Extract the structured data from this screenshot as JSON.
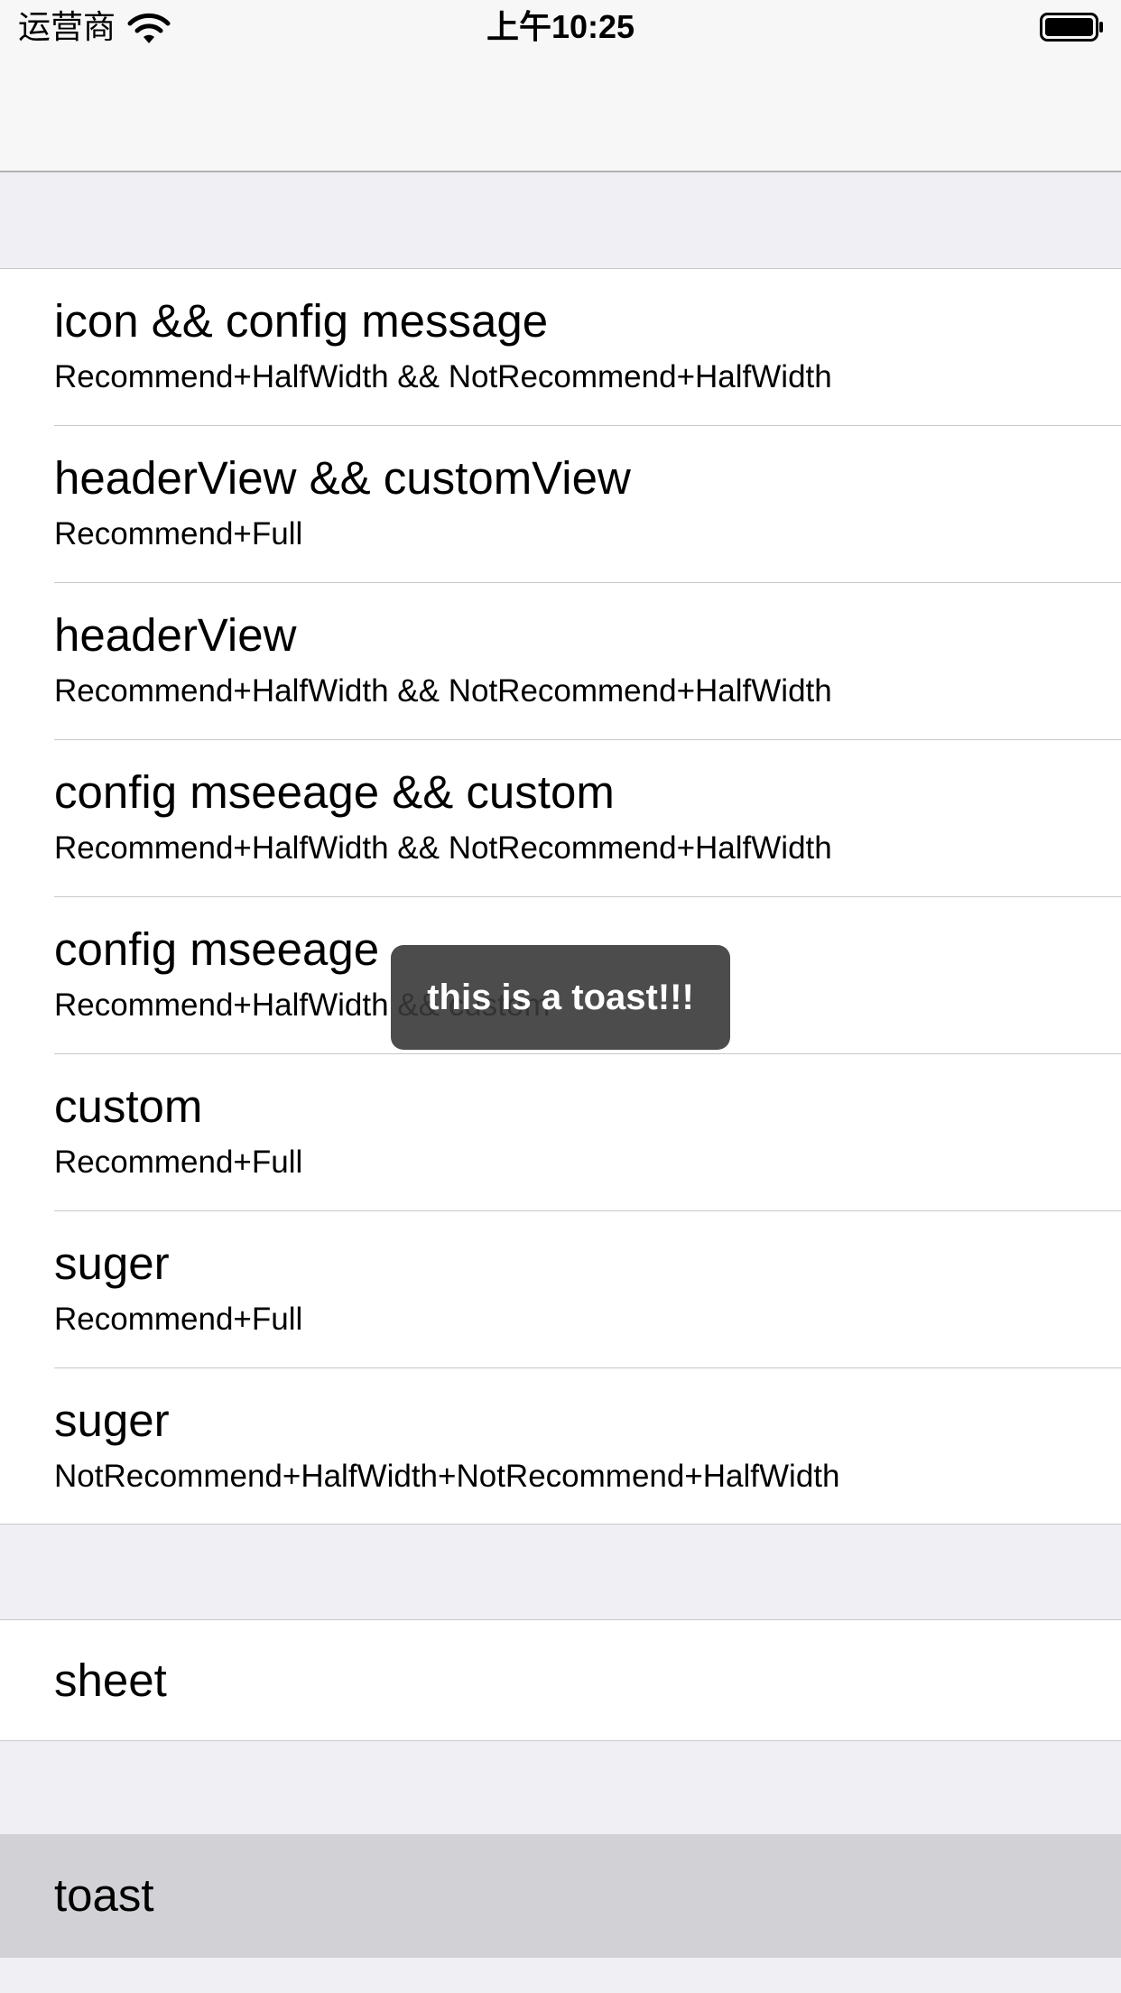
{
  "status_bar": {
    "carrier": "运营商",
    "time": "上午10:25"
  },
  "sections": [
    {
      "items": [
        {
          "title": "icon && config message",
          "subtitle": "Recommend+HalfWidth && NotRecommend+HalfWidth"
        },
        {
          "title": "headerView && customView",
          "subtitle": "Recommend+Full"
        },
        {
          "title": "headerView",
          "subtitle": "Recommend+HalfWidth && NotRecommend+HalfWidth"
        },
        {
          "title": "config mseeage && custom",
          "subtitle": "Recommend+HalfWidth && NotRecommend+HalfWidth"
        },
        {
          "title": "config mseeage",
          "subtitle": "Recommend+HalfWidth && custom"
        },
        {
          "title": "custom",
          "subtitle": "Recommend+Full"
        },
        {
          "title": "suger",
          "subtitle": "Recommend+Full"
        },
        {
          "title": "suger",
          "subtitle": "NotRecommend+HalfWidth+NotRecommend+HalfWidth"
        }
      ]
    },
    {
      "items": [
        {
          "title": "sheet"
        }
      ]
    },
    {
      "items": [
        {
          "title": "toast",
          "highlighted": true
        }
      ]
    }
  ],
  "toast": {
    "message": "this is a toast!!!"
  }
}
